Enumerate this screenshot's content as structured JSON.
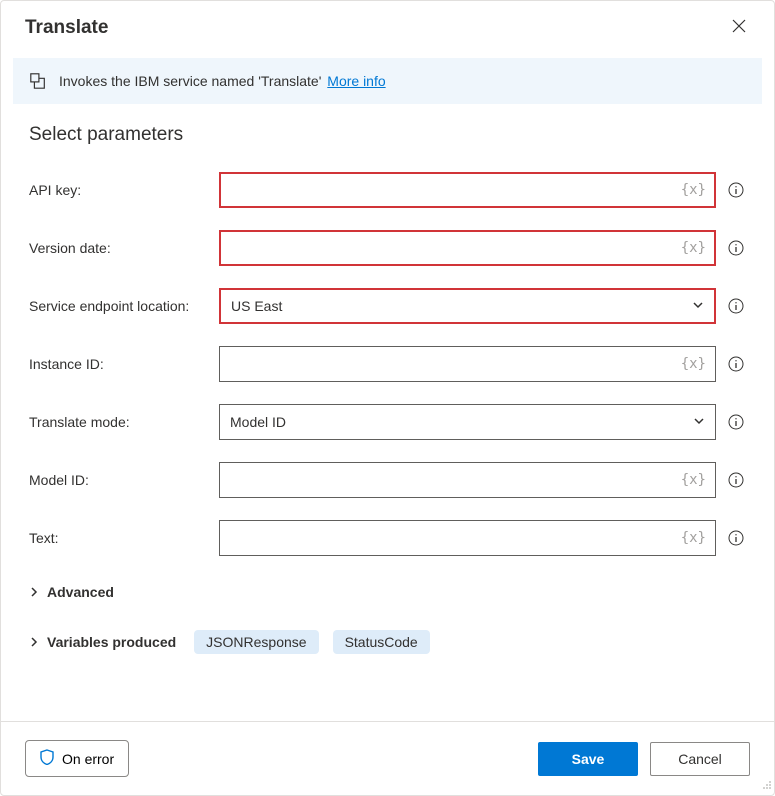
{
  "dialog": {
    "title": "Translate"
  },
  "banner": {
    "text": "Invokes the IBM service named 'Translate'",
    "link_label": "More info"
  },
  "section": {
    "title": "Select parameters"
  },
  "fields": {
    "api_key": {
      "label": "API key:",
      "value": ""
    },
    "version_date": {
      "label": "Version date:",
      "value": ""
    },
    "endpoint": {
      "label": "Service endpoint location:",
      "value": "US East"
    },
    "instance_id": {
      "label": "Instance ID:",
      "value": ""
    },
    "translate_mode": {
      "label": "Translate mode:",
      "value": "Model ID"
    },
    "model_id": {
      "label": "Model ID:",
      "value": ""
    },
    "text": {
      "label": "Text:",
      "value": ""
    }
  },
  "var_marker": "{x}",
  "expand": {
    "advanced": "Advanced",
    "variables_produced": "Variables produced"
  },
  "variables": {
    "json_response": "JSONResponse",
    "status_code": "StatusCode"
  },
  "footer": {
    "on_error": "On error",
    "save": "Save",
    "cancel": "Cancel"
  }
}
